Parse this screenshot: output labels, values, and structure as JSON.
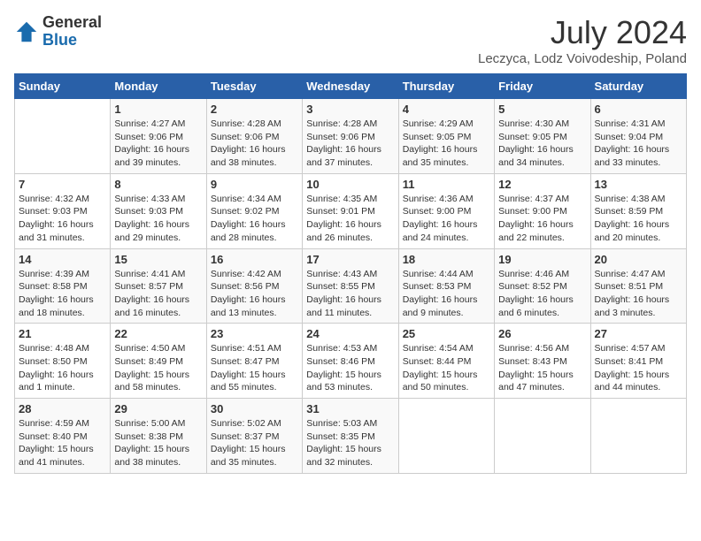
{
  "logo": {
    "general": "General",
    "blue": "Blue"
  },
  "title": "July 2024",
  "subtitle": "Leczyca, Lodz Voivodeship, Poland",
  "days_of_week": [
    "Sunday",
    "Monday",
    "Tuesday",
    "Wednesday",
    "Thursday",
    "Friday",
    "Saturday"
  ],
  "weeks": [
    [
      {
        "day": "",
        "sunrise": "",
        "sunset": "",
        "daylight": ""
      },
      {
        "day": "1",
        "sunrise": "Sunrise: 4:27 AM",
        "sunset": "Sunset: 9:06 PM",
        "daylight": "Daylight: 16 hours and 39 minutes."
      },
      {
        "day": "2",
        "sunrise": "Sunrise: 4:28 AM",
        "sunset": "Sunset: 9:06 PM",
        "daylight": "Daylight: 16 hours and 38 minutes."
      },
      {
        "day": "3",
        "sunrise": "Sunrise: 4:28 AM",
        "sunset": "Sunset: 9:06 PM",
        "daylight": "Daylight: 16 hours and 37 minutes."
      },
      {
        "day": "4",
        "sunrise": "Sunrise: 4:29 AM",
        "sunset": "Sunset: 9:05 PM",
        "daylight": "Daylight: 16 hours and 35 minutes."
      },
      {
        "day": "5",
        "sunrise": "Sunrise: 4:30 AM",
        "sunset": "Sunset: 9:05 PM",
        "daylight": "Daylight: 16 hours and 34 minutes."
      },
      {
        "day": "6",
        "sunrise": "Sunrise: 4:31 AM",
        "sunset": "Sunset: 9:04 PM",
        "daylight": "Daylight: 16 hours and 33 minutes."
      }
    ],
    [
      {
        "day": "7",
        "sunrise": "Sunrise: 4:32 AM",
        "sunset": "Sunset: 9:03 PM",
        "daylight": "Daylight: 16 hours and 31 minutes."
      },
      {
        "day": "8",
        "sunrise": "Sunrise: 4:33 AM",
        "sunset": "Sunset: 9:03 PM",
        "daylight": "Daylight: 16 hours and 29 minutes."
      },
      {
        "day": "9",
        "sunrise": "Sunrise: 4:34 AM",
        "sunset": "Sunset: 9:02 PM",
        "daylight": "Daylight: 16 hours and 28 minutes."
      },
      {
        "day": "10",
        "sunrise": "Sunrise: 4:35 AM",
        "sunset": "Sunset: 9:01 PM",
        "daylight": "Daylight: 16 hours and 26 minutes."
      },
      {
        "day": "11",
        "sunrise": "Sunrise: 4:36 AM",
        "sunset": "Sunset: 9:00 PM",
        "daylight": "Daylight: 16 hours and 24 minutes."
      },
      {
        "day": "12",
        "sunrise": "Sunrise: 4:37 AM",
        "sunset": "Sunset: 9:00 PM",
        "daylight": "Daylight: 16 hours and 22 minutes."
      },
      {
        "day": "13",
        "sunrise": "Sunrise: 4:38 AM",
        "sunset": "Sunset: 8:59 PM",
        "daylight": "Daylight: 16 hours and 20 minutes."
      }
    ],
    [
      {
        "day": "14",
        "sunrise": "Sunrise: 4:39 AM",
        "sunset": "Sunset: 8:58 PM",
        "daylight": "Daylight: 16 hours and 18 minutes."
      },
      {
        "day": "15",
        "sunrise": "Sunrise: 4:41 AM",
        "sunset": "Sunset: 8:57 PM",
        "daylight": "Daylight: 16 hours and 16 minutes."
      },
      {
        "day": "16",
        "sunrise": "Sunrise: 4:42 AM",
        "sunset": "Sunset: 8:56 PM",
        "daylight": "Daylight: 16 hours and 13 minutes."
      },
      {
        "day": "17",
        "sunrise": "Sunrise: 4:43 AM",
        "sunset": "Sunset: 8:55 PM",
        "daylight": "Daylight: 16 hours and 11 minutes."
      },
      {
        "day": "18",
        "sunrise": "Sunrise: 4:44 AM",
        "sunset": "Sunset: 8:53 PM",
        "daylight": "Daylight: 16 hours and 9 minutes."
      },
      {
        "day": "19",
        "sunrise": "Sunrise: 4:46 AM",
        "sunset": "Sunset: 8:52 PM",
        "daylight": "Daylight: 16 hours and 6 minutes."
      },
      {
        "day": "20",
        "sunrise": "Sunrise: 4:47 AM",
        "sunset": "Sunset: 8:51 PM",
        "daylight": "Daylight: 16 hours and 3 minutes."
      }
    ],
    [
      {
        "day": "21",
        "sunrise": "Sunrise: 4:48 AM",
        "sunset": "Sunset: 8:50 PM",
        "daylight": "Daylight: 16 hours and 1 minute."
      },
      {
        "day": "22",
        "sunrise": "Sunrise: 4:50 AM",
        "sunset": "Sunset: 8:49 PM",
        "daylight": "Daylight: 15 hours and 58 minutes."
      },
      {
        "day": "23",
        "sunrise": "Sunrise: 4:51 AM",
        "sunset": "Sunset: 8:47 PM",
        "daylight": "Daylight: 15 hours and 55 minutes."
      },
      {
        "day": "24",
        "sunrise": "Sunrise: 4:53 AM",
        "sunset": "Sunset: 8:46 PM",
        "daylight": "Daylight: 15 hours and 53 minutes."
      },
      {
        "day": "25",
        "sunrise": "Sunrise: 4:54 AM",
        "sunset": "Sunset: 8:44 PM",
        "daylight": "Daylight: 15 hours and 50 minutes."
      },
      {
        "day": "26",
        "sunrise": "Sunrise: 4:56 AM",
        "sunset": "Sunset: 8:43 PM",
        "daylight": "Daylight: 15 hours and 47 minutes."
      },
      {
        "day": "27",
        "sunrise": "Sunrise: 4:57 AM",
        "sunset": "Sunset: 8:41 PM",
        "daylight": "Daylight: 15 hours and 44 minutes."
      }
    ],
    [
      {
        "day": "28",
        "sunrise": "Sunrise: 4:59 AM",
        "sunset": "Sunset: 8:40 PM",
        "daylight": "Daylight: 15 hours and 41 minutes."
      },
      {
        "day": "29",
        "sunrise": "Sunrise: 5:00 AM",
        "sunset": "Sunset: 8:38 PM",
        "daylight": "Daylight: 15 hours and 38 minutes."
      },
      {
        "day": "30",
        "sunrise": "Sunrise: 5:02 AM",
        "sunset": "Sunset: 8:37 PM",
        "daylight": "Daylight: 15 hours and 35 minutes."
      },
      {
        "day": "31",
        "sunrise": "Sunrise: 5:03 AM",
        "sunset": "Sunset: 8:35 PM",
        "daylight": "Daylight: 15 hours and 32 minutes."
      },
      {
        "day": "",
        "sunrise": "",
        "sunset": "",
        "daylight": ""
      },
      {
        "day": "",
        "sunrise": "",
        "sunset": "",
        "daylight": ""
      },
      {
        "day": "",
        "sunrise": "",
        "sunset": "",
        "daylight": ""
      }
    ]
  ]
}
